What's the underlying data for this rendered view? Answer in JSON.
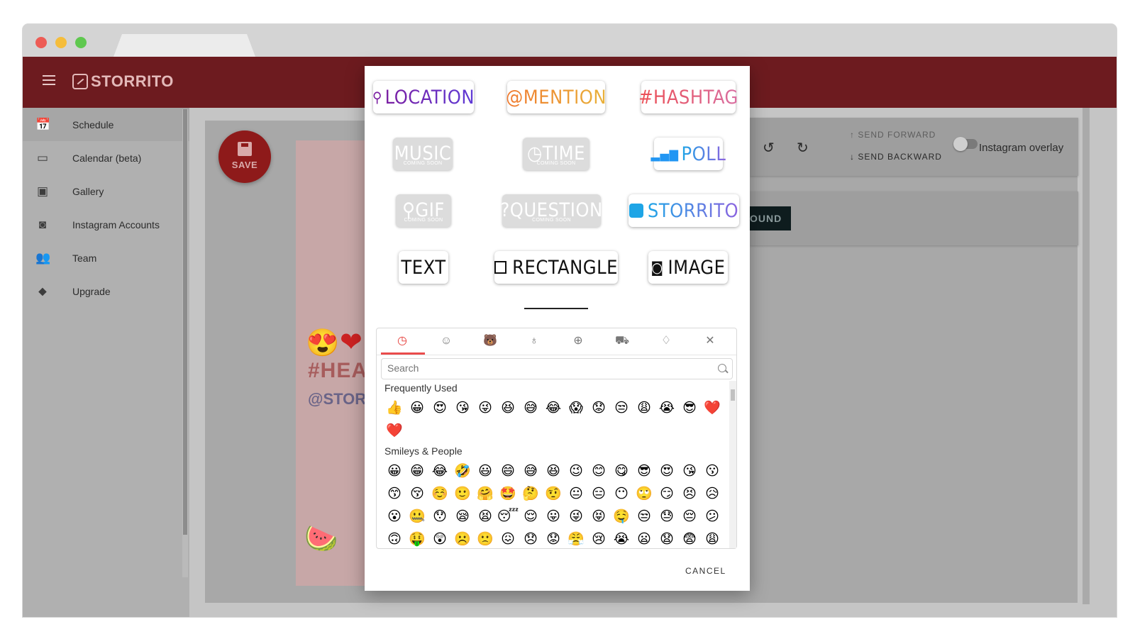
{
  "app": {
    "name": "STORRITO"
  },
  "sidebar": {
    "items": [
      {
        "label": "Schedule",
        "icon": "📅"
      },
      {
        "label": "Calendar (beta)",
        "icon": "▭"
      },
      {
        "label": "Gallery",
        "icon": "▣"
      },
      {
        "label": "Instagram Accounts",
        "icon": "◙"
      },
      {
        "label": "Team",
        "icon": "👥"
      },
      {
        "label": "Upgrade",
        "icon": "⬥"
      }
    ]
  },
  "editor": {
    "save_label": "SAVE",
    "send_forward": "SEND FORWARD",
    "send_backward": "SEND BACKWARD",
    "instagram_overlay": "Instagram overlay",
    "background_button": "OUND",
    "preview_hashtag": "#HEALT",
    "preview_mention": "@STORRIT"
  },
  "stickers": {
    "location": "LOCATION",
    "mention": "@MENTION",
    "hashtag": "#HASHTAG",
    "music": "MUSIC",
    "time": "TIME",
    "poll": "POLL",
    "gif": "GIF",
    "question": "?QUESTION",
    "storrito": "STORRITO",
    "text": "TEXT",
    "rectangle": "RECTANGLE",
    "image": "IMAGE",
    "coming_soon": "COMING SOON"
  },
  "emoji_picker": {
    "search_placeholder": "Search",
    "frequently_used_title": "Frequently Used",
    "frequently_used": [
      "👍",
      "😀",
      "😍",
      "😘",
      "😜",
      "😆",
      "😅",
      "😂",
      "😱",
      "😟",
      "😒",
      "😩",
      "😭",
      "😎",
      "❤️",
      "❤️"
    ],
    "smileys_title": "Smileys & People",
    "smileys": [
      [
        "😀",
        "😁",
        "😂",
        "🤣",
        "😃",
        "😄",
        "😅",
        "😆",
        "😉",
        "😊",
        "😋",
        "😎",
        "😍",
        "😘",
        "😗"
      ],
      [
        "😙",
        "😚",
        "☺️",
        "🙂",
        "🤗",
        "🤩",
        "🤔",
        "🤨",
        "😐",
        "😑",
        "😶",
        "🙄",
        "😏",
        "😣",
        "😥"
      ],
      [
        "😮",
        "🤐",
        "😯",
        "😪",
        "😫",
        "😴",
        "😌",
        "😛",
        "😜",
        "😝",
        "🤤",
        "😒",
        "😓",
        "😔",
        "😕"
      ],
      [
        "🙃",
        "🤑",
        "😲",
        "☹️",
        "🙁",
        "😖",
        "😞",
        "😟",
        "😤",
        "😢",
        "😭",
        "😦",
        "😧",
        "😨",
        "😩"
      ]
    ]
  },
  "modal": {
    "cancel_label": "CANCEL"
  }
}
